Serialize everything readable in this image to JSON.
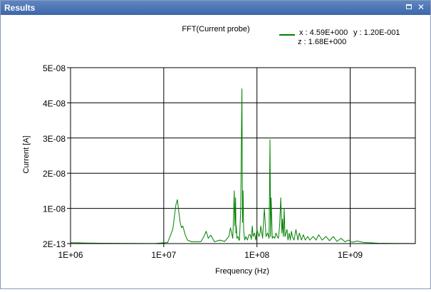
{
  "window": {
    "title": "Results",
    "restore_icon": "restore-icon",
    "close_icon": "close-icon",
    "close_glyph": "✕"
  },
  "readout": {
    "x": "x : 4.59E+000",
    "y": "y : 1.20E-001",
    "z": "z : 1.68E+000",
    "line_color": "#008000"
  },
  "chart_data": {
    "type": "line",
    "title": "FFT(Current probe)",
    "xlabel": "Frequency (Hz)",
    "ylabel": "Current [A]",
    "xscale": "log",
    "xlim": [
      1000000,
      5000000000
    ],
    "ylim": [
      0,
      5e-08
    ],
    "xticks": [
      1000000,
      10000000,
      100000000,
      1000000000
    ],
    "xtick_labels": [
      "1E+06",
      "1E+07",
      "1E+08",
      "1E+09"
    ],
    "yticks": [
      0,
      1e-08,
      2e-08,
      3e-08,
      4e-08,
      5e-08
    ],
    "ytick_labels": [
      "2E-13",
      "1E-08",
      "2E-08",
      "3E-08",
      "4E-08",
      "5E-08"
    ],
    "grid": true,
    "series": [
      {
        "color": "#008000",
        "x": [
          1000000,
          2000000,
          5000000,
          8000000,
          11000000,
          12500000,
          13500000,
          14000000,
          14500000,
          15000000,
          15500000,
          16000000,
          17000000,
          18000000,
          20000000,
          25000000,
          27000000,
          28500000,
          30000000,
          32000000,
          35000000,
          40000000,
          45000000,
          50000000,
          52000000,
          55000000,
          56000000,
          57000000,
          58000000,
          59000000,
          59500000,
          60000000,
          61000000,
          63000000,
          64000000,
          65000000,
          67000000,
          69000000,
          70000000,
          71000000,
          72000000,
          73000000,
          74000000,
          76000000,
          79000000,
          82000000,
          85000000,
          87000000,
          89000000,
          91000000,
          94000000,
          97000000,
          100000000,
          105000000,
          108000000,
          110000000,
          115000000,
          120000000,
          125000000,
          130000000,
          135000000,
          138000000,
          140000000,
          142000000,
          146000000,
          150000000,
          155000000,
          160000000,
          165000000,
          170000000,
          175000000,
          180000000,
          185000000,
          188000000,
          192000000,
          196000000,
          200000000,
          210000000,
          215000000,
          222000000,
          228000000,
          235000000,
          240000000,
          250000000,
          262000000,
          275000000,
          285000000,
          300000000,
          315000000,
          330000000,
          350000000,
          370000000,
          400000000,
          430000000,
          460000000,
          500000000,
          550000000,
          600000000,
          660000000,
          720000000,
          800000000,
          880000000,
          960000000,
          1050000000,
          1200000000,
          1400000000,
          1700000000,
          2000000000,
          3000000000,
          5000000000
        ],
        "y": [
          2.5e-10,
          1e-10,
          5e-11,
          3e-11,
          3e-10,
          4e-09,
          1.1e-08,
          1.25e-08,
          9e-09,
          6e-09,
          4.5e-09,
          5e-09,
          2.5e-09,
          1e-09,
          5e-10,
          5e-10,
          2e-09,
          3.5e-09,
          1.5e-09,
          2.4e-09,
          5e-10,
          1e-09,
          6e-10,
          2e-09,
          4.5e-09,
          1.5e-09,
          7e-09,
          1.5e-08,
          5e-09,
          1.3e-08,
          3e-09,
          5e-09,
          1.5e-09,
          2e-09,
          1e-09,
          1e-09,
          1e-08,
          4.4e-08,
          6e-09,
          1.5e-08,
          4e-09,
          2e-09,
          1e-09,
          2e-09,
          1e-09,
          2.5e-09,
          2.5e-09,
          1.2e-09,
          5e-09,
          2e-09,
          3e-09,
          1e-09,
          4e-09,
          2e-09,
          3e-09,
          5e-09,
          1.5e-09,
          1e-08,
          2e-09,
          3e-09,
          1.5e-09,
          2.95e-08,
          2e-09,
          1.3e-08,
          1.5e-09,
          2e-09,
          1.5e-09,
          3e-09,
          2e-09,
          1.5e-09,
          5e-09,
          1.3e-08,
          3e-09,
          7e-09,
          2e-09,
          1e-08,
          2e-09,
          4e-09,
          1e-09,
          3e-09,
          1e-09,
          3.5e-09,
          2e-09,
          1e-09,
          4e-09,
          1e-09,
          3e-09,
          1e-09,
          2.5e-09,
          1e-09,
          2e-09,
          1e-09,
          2e-09,
          1e-09,
          2.5e-09,
          1e-09,
          2e-09,
          8e-10,
          2e-09,
          6e-10,
          1.5e-09,
          5e-10,
          1e-09,
          4e-10,
          7e-10,
          3e-10,
          2e-10,
          1e-10,
          5e-11,
          3e-11
        ]
      }
    ]
  }
}
